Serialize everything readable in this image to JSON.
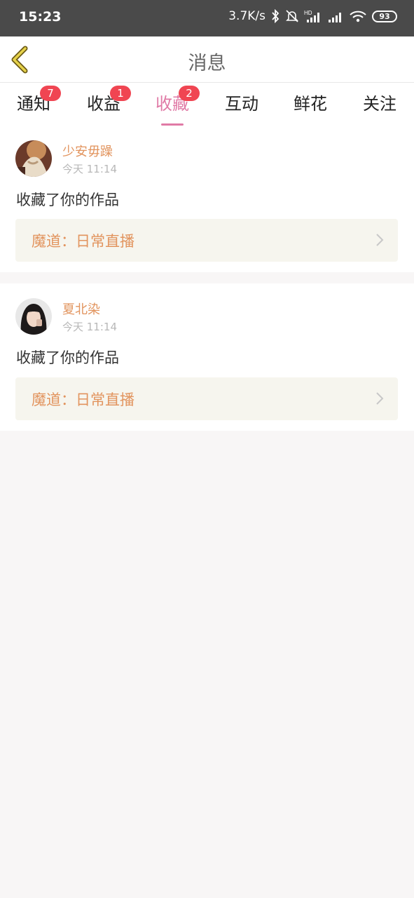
{
  "status_bar": {
    "time": "15:23",
    "network_speed": "3.7K/s",
    "icons": [
      "bluetooth-icon",
      "mute-icon",
      "hd-signal-icon",
      "signal-icon",
      "wifi-icon"
    ],
    "battery_level": "93"
  },
  "header": {
    "title": "消息",
    "back_icon": "chevron-left-icon"
  },
  "tabs": [
    {
      "label": "通知",
      "badge": "7",
      "active": false
    },
    {
      "label": "收益",
      "badge": "1",
      "active": false
    },
    {
      "label": "收藏",
      "badge": "2",
      "active": true
    },
    {
      "label": "互动",
      "badge": "",
      "active": false
    },
    {
      "label": "鲜花",
      "badge": "",
      "active": false
    },
    {
      "label": "关注",
      "badge": "",
      "active": false
    }
  ],
  "messages": [
    {
      "user": "少安毋躁",
      "time": "今天 11:14",
      "text": "收藏了你的作品",
      "work": "魔道：日常直播"
    },
    {
      "user": "夏北染",
      "time": "今天 11:14",
      "text": "收藏了你的作品",
      "work": "魔道：日常直播"
    }
  ],
  "colors": {
    "accent_pink": "#e07aa6",
    "badge_red": "#f04552",
    "name_orange": "#e2945e",
    "status_bar": "#4a4a4a",
    "back_icon": "#c8a81a"
  }
}
